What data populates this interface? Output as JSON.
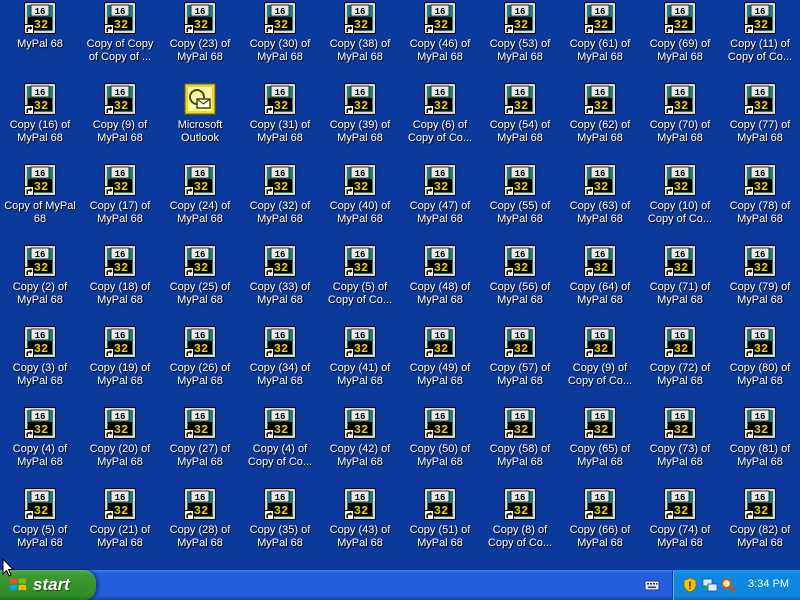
{
  "desktop": {
    "background_color": "#0c3a9c",
    "icons": [
      {
        "label": "MyPal 68",
        "type": "mypal-shortcut"
      },
      {
        "label": "Copy of Copy of Copy of ...",
        "type": "mypal-shortcut"
      },
      {
        "label": "Copy (23) of MyPal 68",
        "type": "mypal-shortcut"
      },
      {
        "label": "Copy (30) of MyPal 68",
        "type": "mypal-shortcut"
      },
      {
        "label": "Copy (38) of MyPal 68",
        "type": "mypal-shortcut"
      },
      {
        "label": "Copy (46) of MyPal 68",
        "type": "mypal-shortcut"
      },
      {
        "label": "Copy (53) of MyPal 68",
        "type": "mypal-shortcut"
      },
      {
        "label": "Copy (61) of MyPal 68",
        "type": "mypal-shortcut"
      },
      {
        "label": "Copy (69) of MyPal 68",
        "type": "mypal-shortcut"
      },
      {
        "label": "Copy (11) of Copy of Co...",
        "type": "mypal-shortcut"
      },
      {
        "label": "Copy (16) of MyPal 68",
        "type": "mypal-shortcut"
      },
      {
        "label": "Copy (9) of MyPal 68",
        "type": "mypal-shortcut"
      },
      {
        "label": "Microsoft Outlook",
        "type": "outlook"
      },
      {
        "label": "Copy (31) of MyPal 68",
        "type": "mypal-shortcut"
      },
      {
        "label": "Copy (39) of MyPal 68",
        "type": "mypal-shortcut"
      },
      {
        "label": "Copy (6) of Copy of Co...",
        "type": "mypal-shortcut"
      },
      {
        "label": "Copy (54) of MyPal 68",
        "type": "mypal-shortcut"
      },
      {
        "label": "Copy (62) of MyPal 68",
        "type": "mypal-shortcut"
      },
      {
        "label": "Copy (70) of MyPal 68",
        "type": "mypal-shortcut"
      },
      {
        "label": "Copy (77) of MyPal 68",
        "type": "mypal-shortcut"
      },
      {
        "label": "Copy of MyPal 68",
        "type": "mypal-shortcut"
      },
      {
        "label": "Copy (17) of MyPal 68",
        "type": "mypal-shortcut"
      },
      {
        "label": "Copy (24) of MyPal 68",
        "type": "mypal-shortcut"
      },
      {
        "label": "Copy (32) of MyPal 68",
        "type": "mypal-shortcut"
      },
      {
        "label": "Copy (40) of MyPal 68",
        "type": "mypal-shortcut"
      },
      {
        "label": "Copy (47) of MyPal 68",
        "type": "mypal-shortcut"
      },
      {
        "label": "Copy (55) of MyPal 68",
        "type": "mypal-shortcut"
      },
      {
        "label": "Copy (63) of MyPal 68",
        "type": "mypal-shortcut"
      },
      {
        "label": "Copy (10) of Copy of Co...",
        "type": "mypal-shortcut"
      },
      {
        "label": "Copy (78) of MyPal 68",
        "type": "mypal-shortcut"
      },
      {
        "label": "Copy (2) of MyPal 68",
        "type": "mypal-shortcut"
      },
      {
        "label": "Copy (18) of MyPal 68",
        "type": "mypal-shortcut"
      },
      {
        "label": "Copy (25) of MyPal 68",
        "type": "mypal-shortcut"
      },
      {
        "label": "Copy (33) of MyPal 68",
        "type": "mypal-shortcut"
      },
      {
        "label": "Copy (5) of Copy of Co...",
        "type": "mypal-shortcut"
      },
      {
        "label": "Copy (48) of MyPal 68",
        "type": "mypal-shortcut"
      },
      {
        "label": "Copy (56) of MyPal 68",
        "type": "mypal-shortcut"
      },
      {
        "label": "Copy (64) of MyPal 68",
        "type": "mypal-shortcut"
      },
      {
        "label": "Copy (71) of MyPal 68",
        "type": "mypal-shortcut"
      },
      {
        "label": "Copy (79) of MyPal 68",
        "type": "mypal-shortcut"
      },
      {
        "label": "Copy (3) of MyPal 68",
        "type": "mypal-shortcut"
      },
      {
        "label": "Copy (19) of MyPal 68",
        "type": "mypal-shortcut"
      },
      {
        "label": "Copy (26) of MyPal 68",
        "type": "mypal-shortcut"
      },
      {
        "label": "Copy (34) of MyPal 68",
        "type": "mypal-shortcut"
      },
      {
        "label": "Copy (41) of MyPal 68",
        "type": "mypal-shortcut"
      },
      {
        "label": "Copy (49) of MyPal 68",
        "type": "mypal-shortcut"
      },
      {
        "label": "Copy (57) of MyPal 68",
        "type": "mypal-shortcut"
      },
      {
        "label": "Copy (9) of Copy of Co...",
        "type": "mypal-shortcut"
      },
      {
        "label": "Copy (72) of MyPal 68",
        "type": "mypal-shortcut"
      },
      {
        "label": "Copy (80) of MyPal 68",
        "type": "mypal-shortcut"
      },
      {
        "label": "Copy (4) of MyPal 68",
        "type": "mypal-shortcut"
      },
      {
        "label": "Copy (20) of MyPal 68",
        "type": "mypal-shortcut"
      },
      {
        "label": "Copy (27) of MyPal 68",
        "type": "mypal-shortcut"
      },
      {
        "label": "Copy (4) of Copy of Co...",
        "type": "mypal-shortcut"
      },
      {
        "label": "Copy (42) of MyPal 68",
        "type": "mypal-shortcut"
      },
      {
        "label": "Copy (50) of MyPal 68",
        "type": "mypal-shortcut"
      },
      {
        "label": "Copy (58) of MyPal 68",
        "type": "mypal-shortcut"
      },
      {
        "label": "Copy (65) of MyPal 68",
        "type": "mypal-shortcut"
      },
      {
        "label": "Copy (73) of MyPal 68",
        "type": "mypal-shortcut"
      },
      {
        "label": "Copy (81) of MyPal 68",
        "type": "mypal-shortcut"
      },
      {
        "label": "Copy (5) of MyPal 68",
        "type": "mypal-shortcut"
      },
      {
        "label": "Copy (21) of MyPal 68",
        "type": "mypal-shortcut"
      },
      {
        "label": "Copy (28) of MyPal 68",
        "type": "mypal-shortcut"
      },
      {
        "label": "Copy (35) of MyPal 68",
        "type": "mypal-shortcut"
      },
      {
        "label": "Copy (43) of MyPal 68",
        "type": "mypal-shortcut"
      },
      {
        "label": "Copy (51) of MyPal 68",
        "type": "mypal-shortcut"
      },
      {
        "label": "Copy (8) of Copy of Co...",
        "type": "mypal-shortcut"
      },
      {
        "label": "Copy (66) of MyPal 68",
        "type": "mypal-shortcut"
      },
      {
        "label": "Copy (74) of MyPal 68",
        "type": "mypal-shortcut"
      },
      {
        "label": "Copy (82) of MyPal 68",
        "type": "mypal-shortcut"
      }
    ],
    "mypal_icon_text_top": "16",
    "mypal_icon_text_bottom": "32"
  },
  "taskbar": {
    "start_label": "start",
    "clock": "3:34 PM",
    "tray_icons": [
      "security-shield-icon",
      "network-icon",
      "search-icon"
    ],
    "language_bar_icon": "keyboard-icon",
    "colors": {
      "taskbar": "#245edb",
      "start_button": "#3c9a34",
      "tray": "#0f89e4"
    }
  }
}
